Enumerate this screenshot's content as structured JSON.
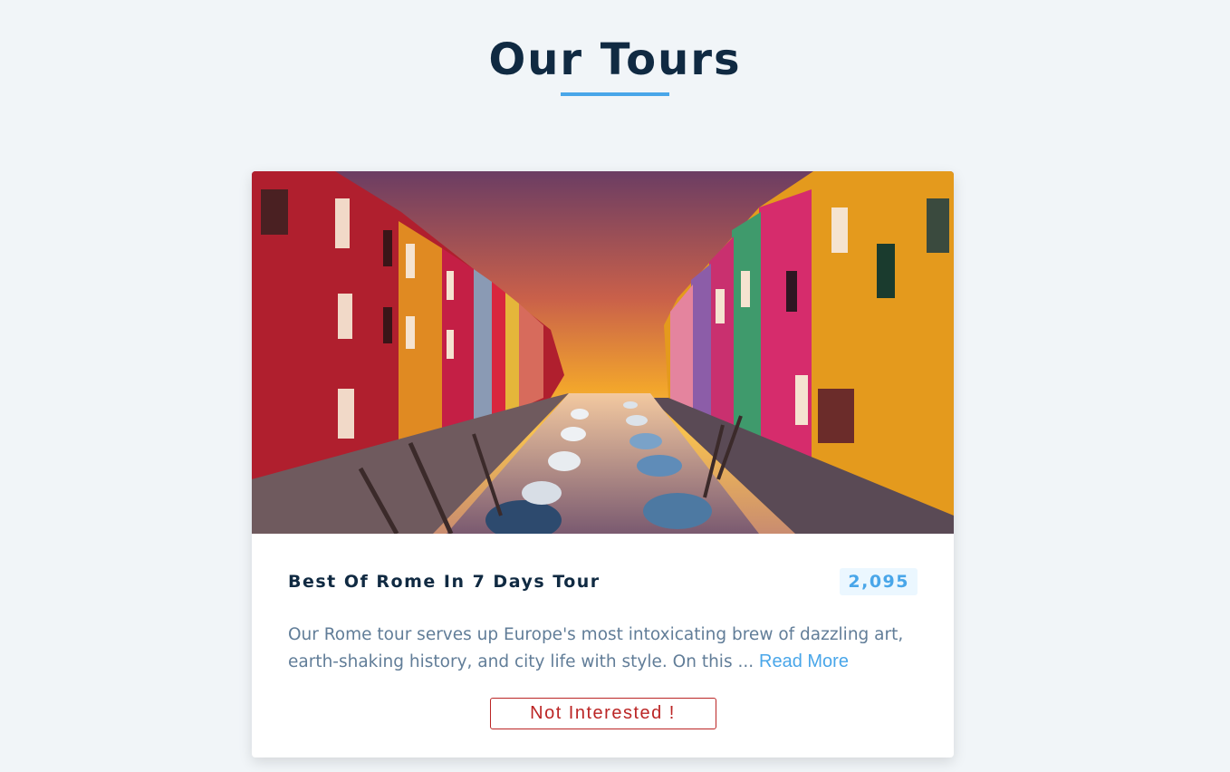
{
  "header": {
    "title": "Our Tours"
  },
  "tours": [
    {
      "name": "Best Of Rome In 7 Days Tour",
      "price": "2,095",
      "description": "Our Rome tour serves up Europe's most intoxicating brew of dazzling art, earth-shaking history, and city life with style. On this ...",
      "read_more_label": "Read More",
      "not_interested_label": "Not Interested !",
      "image_alt": "Colorful canal street with boats at sunset"
    }
  ],
  "colors": {
    "background": "#f1f5f8",
    "title": "#102a42",
    "accent": "#49a6e9",
    "price_bg": "#ebf7ff",
    "text": "#617d98",
    "danger": "#bb2525"
  }
}
